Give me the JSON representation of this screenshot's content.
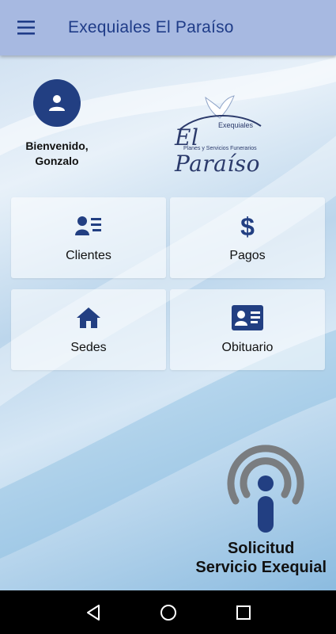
{
  "app": {
    "title": "Exequiales El Paraíso"
  },
  "user": {
    "welcome_line1": "Bienvenido,",
    "welcome_line2": "Gonzalo",
    "avatar_icon": "user-icon"
  },
  "logo": {
    "top": "Exequiales",
    "main": "El Paraíso",
    "sub": "Planes y Servicios Funerarios"
  },
  "menu": [
    {
      "label": "Clientes",
      "icon": "clients-list-icon"
    },
    {
      "label": "Pagos",
      "icon": "dollar-icon"
    },
    {
      "label": "Sedes",
      "icon": "home-icon"
    },
    {
      "label": "Obituario",
      "icon": "id-card-icon"
    }
  ],
  "request": {
    "line1": "Solicitud",
    "line2": "Servicio Exequial",
    "icon": "broadcast-person-icon"
  },
  "colors": {
    "brand": "#223f82",
    "appbar": "#a7b9e1"
  },
  "system_nav": [
    "back-icon",
    "home-circle-icon",
    "recents-icon"
  ]
}
